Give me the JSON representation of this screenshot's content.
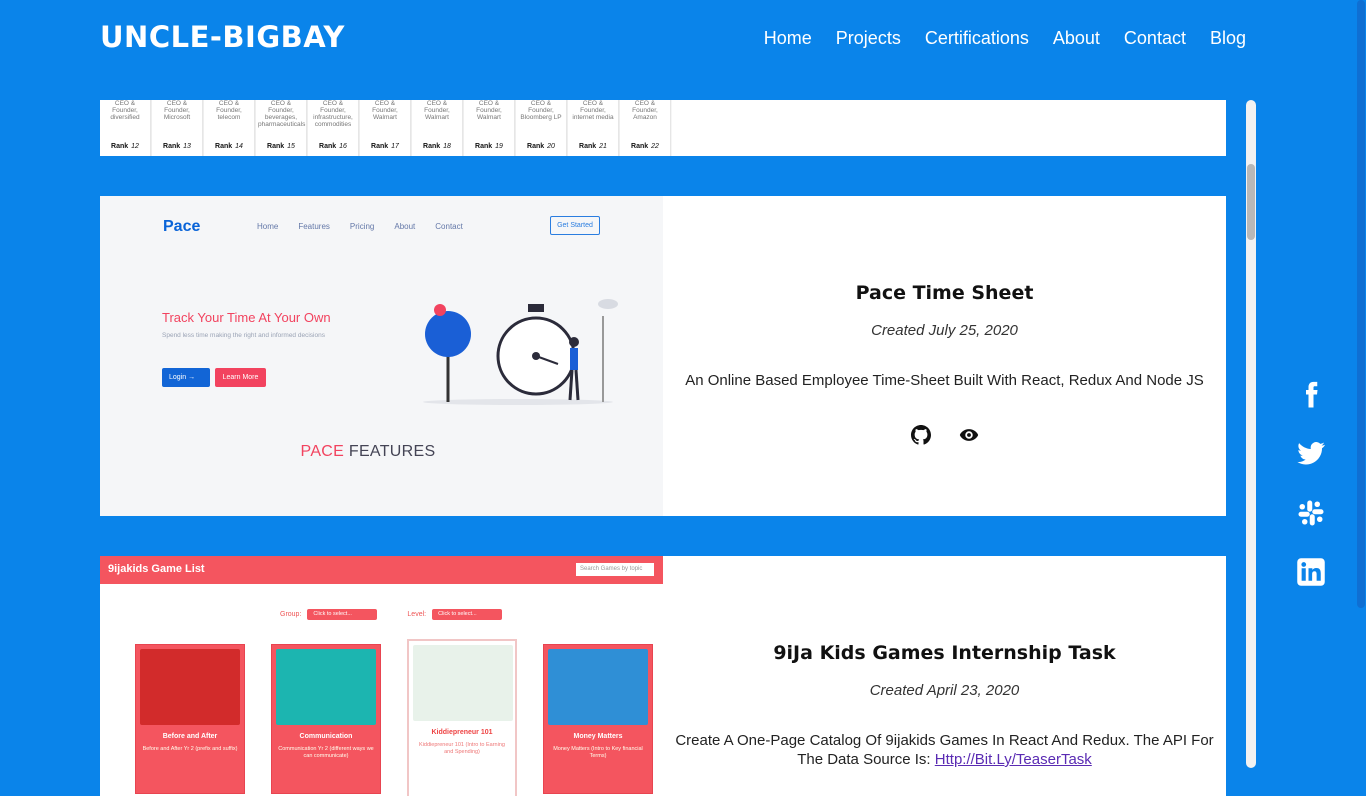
{
  "brand": "UNCLE-BIGBAY",
  "nav": [
    "Home",
    "Projects",
    "Certifications",
    "About",
    "Contact",
    "Blog"
  ],
  "social": [
    "facebook-icon",
    "twitter-icon",
    "slack-icon",
    "linkedin-icon"
  ],
  "top_card_ranks": [
    {
      "desc": "CEO & Founder, diversified",
      "rank": "12"
    },
    {
      "desc": "CEO & Founder, Microsoft",
      "rank": "13"
    },
    {
      "desc": "CEO & Founder, telecom",
      "rank": "14"
    },
    {
      "desc": "CEO & Founder, beverages, pharmaceuticals",
      "rank": "15"
    },
    {
      "desc": "CEO & Founder, infrastructure, commodities",
      "rank": "16"
    },
    {
      "desc": "CEO & Founder, Walmart",
      "rank": "17"
    },
    {
      "desc": "CEO & Founder, Walmart",
      "rank": "18"
    },
    {
      "desc": "CEO & Founder, Walmart",
      "rank": "19"
    },
    {
      "desc": "CEO & Founder, Bloomberg LP",
      "rank": "20"
    },
    {
      "desc": "CEO & Founder, internet media",
      "rank": "21"
    },
    {
      "desc": "CEO & Founder, Amazon",
      "rank": "22"
    }
  ],
  "rank_prefix": "Rank",
  "projects": [
    {
      "title": "Pace Time Sheet",
      "date": "Created July 25, 2020",
      "description": "An Online Based Employee Time-Sheet Built With React, Redux And Node JS",
      "links": [
        "github-icon",
        "eye-icon"
      ],
      "preview": {
        "brand": "Pace",
        "nav": [
          "Home",
          "Features",
          "Pricing",
          "About",
          "Contact"
        ],
        "cta": "Get Started",
        "headline": "Track Your Time At Your Own",
        "sub": "Spend less time making the right and informed decisions",
        "login": "Login →",
        "learn": "Learn More",
        "features_accent": "PACE",
        "features_rest": " FEATURES"
      }
    },
    {
      "title": "9iJa Kids Games Internship Task",
      "date": "Created April 23, 2020",
      "description": "Create A One-Page Catalog Of 9ijakids Games In React And Redux. The API For The Data Source Is: ",
      "link_text": "Http://Bit.Ly/TeaserTask",
      "preview": {
        "title": "9ijakids Game List",
        "search": "Search Games by topic",
        "group_label": "Group:",
        "level_label": "Level:",
        "select_placeholder": "Click to select...",
        "games": [
          {
            "name": "Before and After",
            "desc": "Before and After Yr 2 (prefix and suffix)"
          },
          {
            "name": "Communication",
            "desc": "Communication Yr 2 (different ways we can communicate)"
          },
          {
            "name": "Kiddiepreneur 101",
            "desc": "Kiddiepreneur 101 (Intro to Earning and Spending)"
          },
          {
            "name": "Money Matters",
            "desc": "Money Matters (Intro to Key financial Terms)"
          }
        ]
      }
    }
  ],
  "colors": {
    "page_bg": "#0a84ea",
    "accent": "#f2435f",
    "game_red": "#f4555f"
  }
}
